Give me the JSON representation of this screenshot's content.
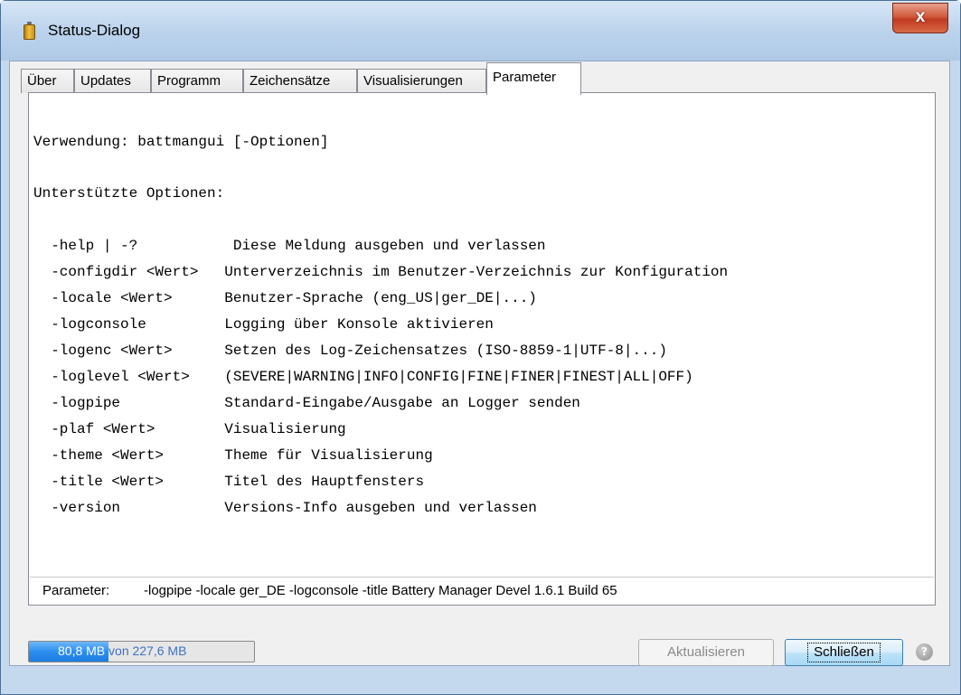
{
  "window": {
    "title": "Status-Dialog",
    "close_glyph": "x"
  },
  "tabs": [
    {
      "label": "Über",
      "active": false
    },
    {
      "label": "Updates",
      "active": false
    },
    {
      "label": "Programm",
      "active": false
    },
    {
      "label": "Zeichensätze",
      "active": false
    },
    {
      "label": "Visualisierungen",
      "active": false
    },
    {
      "label": "Parameter",
      "active": true
    }
  ],
  "help_text": {
    "usage": "Verwendung: battmangui [-Optionen]",
    "supported_header": "Unterstützte Optionen:",
    "options": [
      {
        "option": "  -help | -?           ",
        "description": "Diese Meldung ausgeben und verlassen"
      },
      {
        "option": "  -configdir <Wert>   ",
        "description": "Unterverzeichnis im Benutzer-Verzeichnis zur Konfiguration"
      },
      {
        "option": "  -locale <Wert>      ",
        "description": "Benutzer-Sprache (eng_US|ger_DE|...)"
      },
      {
        "option": "  -logconsole         ",
        "description": "Logging über Konsole aktivieren"
      },
      {
        "option": "  -logenc <Wert>      ",
        "description": "Setzen des Log-Zeichensatzes (ISO-8859-1|UTF-8|...)"
      },
      {
        "option": "  -loglevel <Wert>    ",
        "description": "(SEVERE|WARNING|INFO|CONFIG|FINE|FINER|FINEST|ALL|OFF)"
      },
      {
        "option": "  -logpipe            ",
        "description": "Standard-Eingabe/Ausgabe an Logger senden"
      },
      {
        "option": "  -plaf <Wert>        ",
        "description": "Visualisierung"
      },
      {
        "option": "  -theme <Wert>       ",
        "description": "Theme für Visualisierung"
      },
      {
        "option": "  -title <Wert>       ",
        "description": "Titel des Hauptfensters"
      },
      {
        "option": "  -version            ",
        "description": "Versions-Info ausgeben und verlassen"
      }
    ]
  },
  "parameters": {
    "label": "Parameter:",
    "value": "-logpipe -locale ger_DE -logconsole -title Battery Manager Devel 1.6.1 Build 65"
  },
  "memory": {
    "text": "80,8 MB von 227,6 MB",
    "used_fraction": 0.355
  },
  "buttons": {
    "refresh_label": "Aktualisieren",
    "refresh_enabled": false,
    "close_label": "Schließen",
    "help_glyph": "?"
  },
  "colors": {
    "memory_bar": "#2c8ef0",
    "close_button": "#c03a20"
  }
}
